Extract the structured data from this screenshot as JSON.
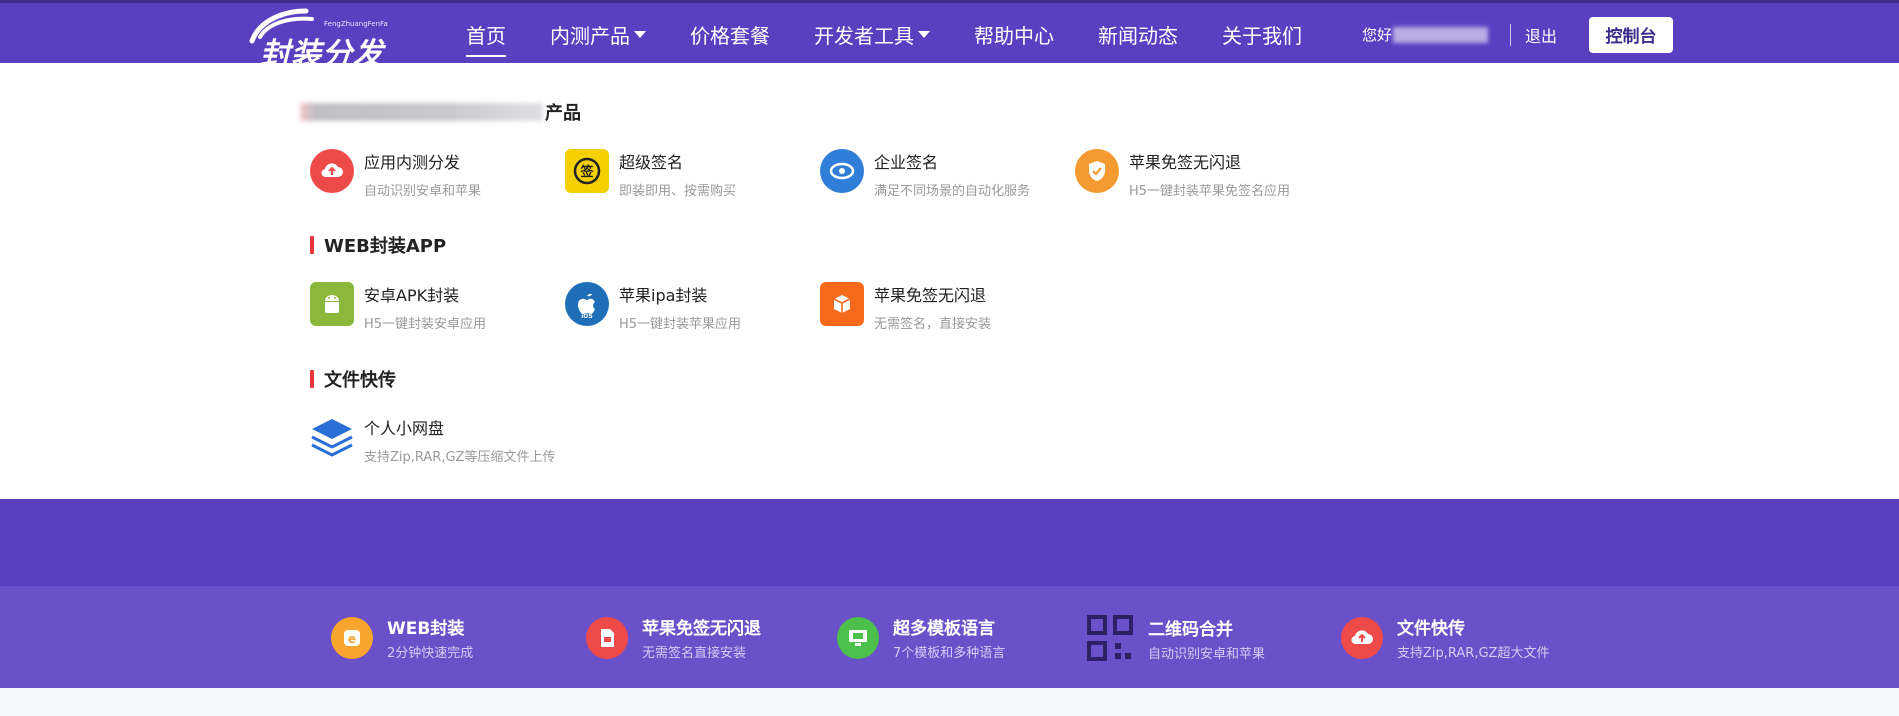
{
  "logo": {
    "main": "封装分发",
    "sub": "FengZhuangFenFa"
  },
  "nav": {
    "items": [
      {
        "label": "首页",
        "active": true,
        "dropdown": false
      },
      {
        "label": "内测产品",
        "active": false,
        "dropdown": true
      },
      {
        "label": "价格套餐",
        "active": false,
        "dropdown": false
      },
      {
        "label": "开发者工具",
        "active": false,
        "dropdown": true
      },
      {
        "label": "帮助中心",
        "active": false,
        "dropdown": false
      },
      {
        "label": "新闻动态",
        "active": false,
        "dropdown": false
      },
      {
        "label": "关于我们",
        "active": false,
        "dropdown": false
      }
    ]
  },
  "user": {
    "greet": "您好",
    "logout": "退出",
    "console": "控制台"
  },
  "dropdown": {
    "sections": [
      {
        "title": "产品",
        "items": [
          {
            "name": "应用内测分发",
            "desc": "自动识别安卓和苹果",
            "icon": "cloud-upload-icon",
            "color": "#ef4a4a"
          },
          {
            "name": "超级签名",
            "desc": "即装即用、按需购买",
            "icon": "signature-icon",
            "color": "#f5d000"
          },
          {
            "name": "企业签名",
            "desc": "满足不同场景的自动化服务",
            "icon": "link-icon",
            "color": "#2f7fd8"
          },
          {
            "name": "苹果免签无闪退",
            "desc": "H5一键封装苹果免签名应用",
            "icon": "shield-check-icon",
            "color": "#f59a30"
          }
        ]
      },
      {
        "title": "WEB封装APP",
        "items": [
          {
            "name": "安卓APK封装",
            "desc": "H5一键封装安卓应用",
            "icon": "android-icon",
            "color": "#8bb83a"
          },
          {
            "name": "苹果ipa封装",
            "desc": "H5一键封装苹果应用",
            "icon": "apple-ios-icon",
            "color": "#1f6fb8"
          },
          {
            "name": "苹果免签无闪退",
            "desc": "无需签名，直接安装",
            "icon": "box-icon",
            "color": "#f56a1a"
          }
        ]
      },
      {
        "title": "文件快传",
        "items": [
          {
            "name": "个人小网盘",
            "desc": "支持Zip,RAR,GZ等压缩文件上传",
            "icon": "layers-icon",
            "color": "#2a6fd6"
          }
        ]
      }
    ]
  },
  "features": [
    {
      "name": "WEB封装",
      "desc": "2分钟快速完成",
      "icon": "web-e-icon",
      "color": "#f7a52d"
    },
    {
      "name": "苹果免签无闪退",
      "desc": "无需签名直接安装",
      "icon": "document-icon",
      "color": "#ef4a4a"
    },
    {
      "name": "超多模板语言",
      "desc": "7个模板和多种语言",
      "icon": "monitor-icon",
      "color": "#4cc04a"
    },
    {
      "name": "二维码合并",
      "desc": "自动识别安卓和苹果",
      "icon": "qrcode-icon",
      "color": "#3b2a8a"
    },
    {
      "name": "文件快传",
      "desc": "支持Zip,RAR,GZ超大文件",
      "icon": "cloud-upload-icon",
      "color": "#ef4a4a"
    }
  ]
}
